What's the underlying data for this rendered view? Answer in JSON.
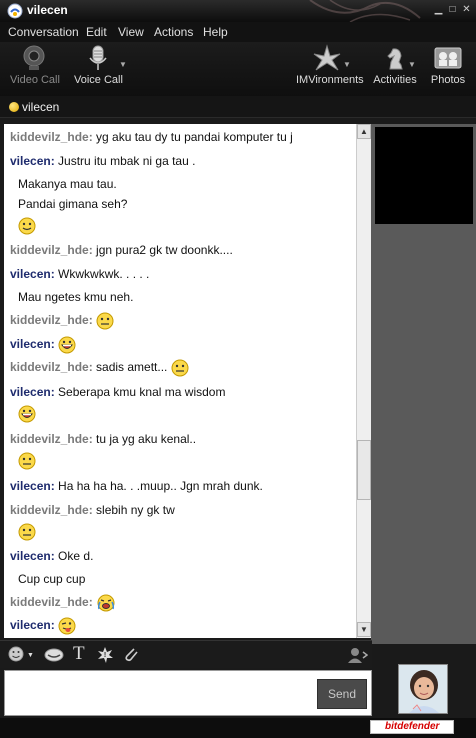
{
  "window": {
    "title": "vilecen"
  },
  "menu": [
    "Conversation",
    "Edit",
    "View",
    "Actions",
    "Help"
  ],
  "toolbar": {
    "video_call": "Video Call",
    "voice_call": "Voice Call",
    "imvironments": "IMVironments",
    "activities": "Activities",
    "photos": "Photos"
  },
  "status": {
    "name": "vilecen"
  },
  "chat": {
    "messages": [
      {
        "nick": "kiddevilz_hde:",
        "text": "yg aku tau dy tu pandai komputer tu j"
      },
      {
        "nick": "vilecen:",
        "text": "Justru itu mbak ni ga tau ."
      },
      {
        "text": "Makanya mau tau."
      },
      {
        "text": "Pandai gimana seh?"
      },
      {
        "emoticon": "smile-emoticon"
      },
      {
        "nick": "kiddevilz_hde:",
        "text": "jgn pura2 gk tw doonkk...."
      },
      {
        "nick": "vilecen:",
        "text": "Wkwkwkwk. . . . ."
      },
      {
        "text": "Mau ngetes kmu neh."
      },
      {
        "nick": "kiddevilz_hde:",
        "emoticon": "straight-face-emoticon"
      },
      {
        "nick": "vilecen:",
        "emoticon": "grin-emoticon"
      },
      {
        "nick": "kiddevilz_hde:",
        "text": "sadis amett...",
        "emoticon": "straight-face-emoticon"
      },
      {
        "nick": "vilecen:",
        "text": "Seberapa kmu knal ma wisdom"
      },
      {
        "emoticon": "grin-emoticon"
      },
      {
        "nick": "kiddevilz_hde:",
        "text": "tu ja yg aku kenal.."
      },
      {
        "emoticon": "straight-face-emoticon"
      },
      {
        "nick": "vilecen:",
        "text": "Ha ha ha ha. . .muup.. Jgn mrah dunk."
      },
      {
        "nick": "kiddevilz_hde:",
        "text": "slebih ny gk tw"
      },
      {
        "emoticon": "straight-face-emoticon"
      },
      {
        "nick": "vilecen:",
        "text": "Oke d."
      },
      {
        "text": "Cup cup cup"
      },
      {
        "nick": "kiddevilz_hde:",
        "emoticon": "crying-emoticon"
      },
      {
        "nick": "vilecen:",
        "emoticon": "tongue-emoticon"
      }
    ]
  },
  "input": {
    "value": "",
    "send_label": "Send"
  },
  "footer": {
    "brand": "bitdefender"
  },
  "colors": {
    "kiddevilz_nick": "#7a7a7a",
    "vilecen_nick": "#1f2c6e",
    "window_bg": "#1a1a1a",
    "accent_red": "#d60000"
  }
}
